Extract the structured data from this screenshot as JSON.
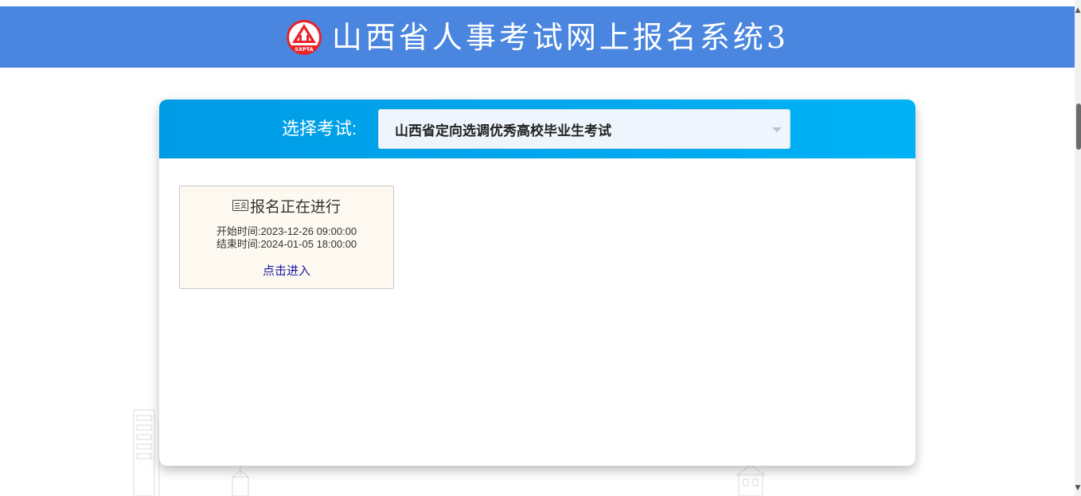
{
  "header": {
    "title": "山西省人事考试网上报名系统3",
    "logo_text": "SXPTA",
    "background_color": "#4a86e0"
  },
  "exam_selector": {
    "label": "选择考试:",
    "selected": "山西省定向选调优秀高校毕业生考试"
  },
  "exam_card": {
    "status": "报名正在进行",
    "status_icon": "id-card-icon",
    "start_label": "开始时间:",
    "start_time": "2023-12-26 09:00:00",
    "end_label": "结束时间:",
    "end_time": "2024-01-05 18:00:00",
    "enter_link": "点击进入"
  },
  "colors": {
    "card_header_gradient_start": "#009be5",
    "card_header_gradient_end": "#00b2f5",
    "link": "#1a1aa6",
    "card_background": "#fdf9f0"
  }
}
